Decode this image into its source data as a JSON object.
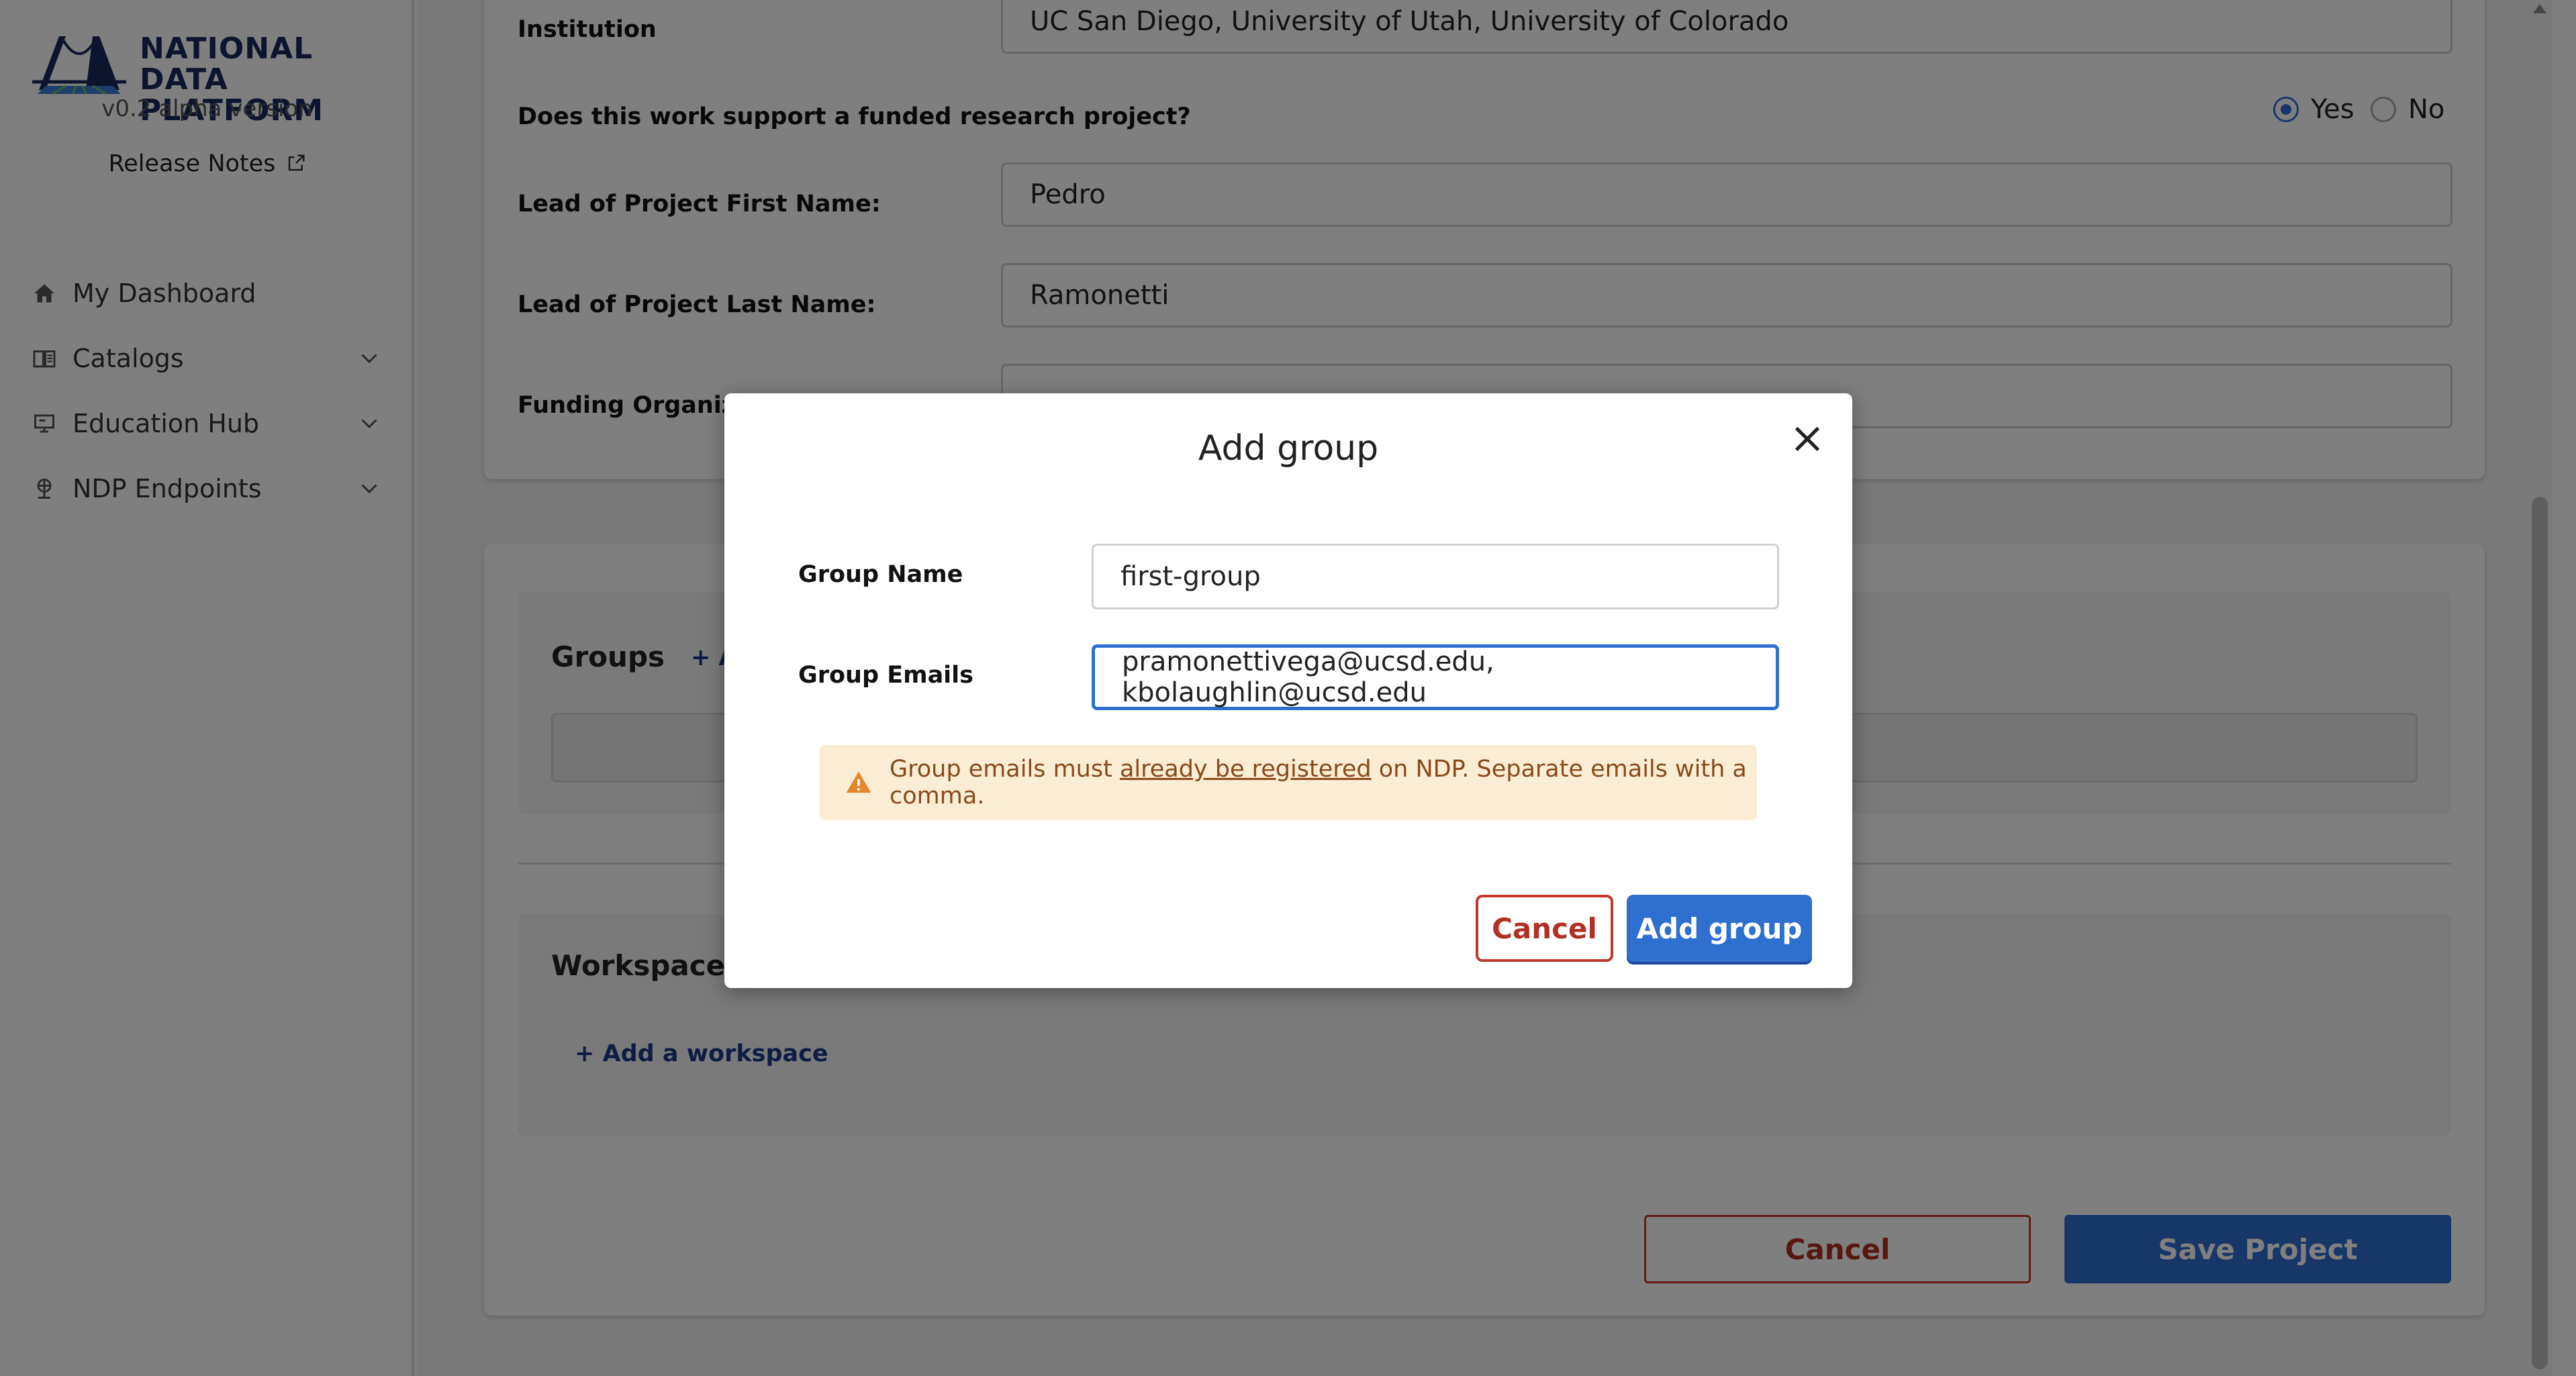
{
  "sidebar": {
    "logo_line1": "NATIONAL",
    "logo_line2": "DATA PLATFORM",
    "version": "v0.2 alpha version",
    "release_notes": "Release Notes",
    "nav": [
      {
        "label": "My Dashboard",
        "icon": "home-icon"
      },
      {
        "label": "Catalogs",
        "icon": "catalog-icon"
      },
      {
        "label": "Education Hub",
        "icon": "education-icon"
      },
      {
        "label": "NDP Endpoints",
        "icon": "endpoints-icon"
      }
    ]
  },
  "form": {
    "institution_label": "Institution",
    "institution_value": "UC San Diego, University of Utah, University of Colorado",
    "funded_question": "Does this work support a funded research project?",
    "yes_label": "Yes",
    "no_label": "No",
    "lead_first_label": "Lead of Project First Name:",
    "lead_first_value": "Pedro",
    "lead_last_label": "Lead of Project Last Name:",
    "lead_last_value": "Ramonetti",
    "funding_label": "Funding Organiz",
    "groups_title": "Groups",
    "groups_add": "+ A",
    "workspaces_title": "Workspaces",
    "workspace_add": "+  Add a workspace",
    "cancel": "Cancel",
    "save": "Save Project"
  },
  "modal": {
    "title": "Add group",
    "group_name_label": "Group Name",
    "group_name_value": "first-group",
    "group_emails_label": "Group Emails",
    "group_emails_value": "pramonettivega@ucsd.edu, kbolaughlin@ucsd.edu",
    "warning_pre": "Group emails must ",
    "warning_link": "already be registered",
    "warning_post": " on NDP. Separate emails with a comma.",
    "cancel": "Cancel",
    "add": "Add group"
  },
  "colors": {
    "accent": "#2f6fd0",
    "danger": "#c0392b",
    "warning_bg": "#fbedd4",
    "brand_navy": "#1b2a5c"
  }
}
